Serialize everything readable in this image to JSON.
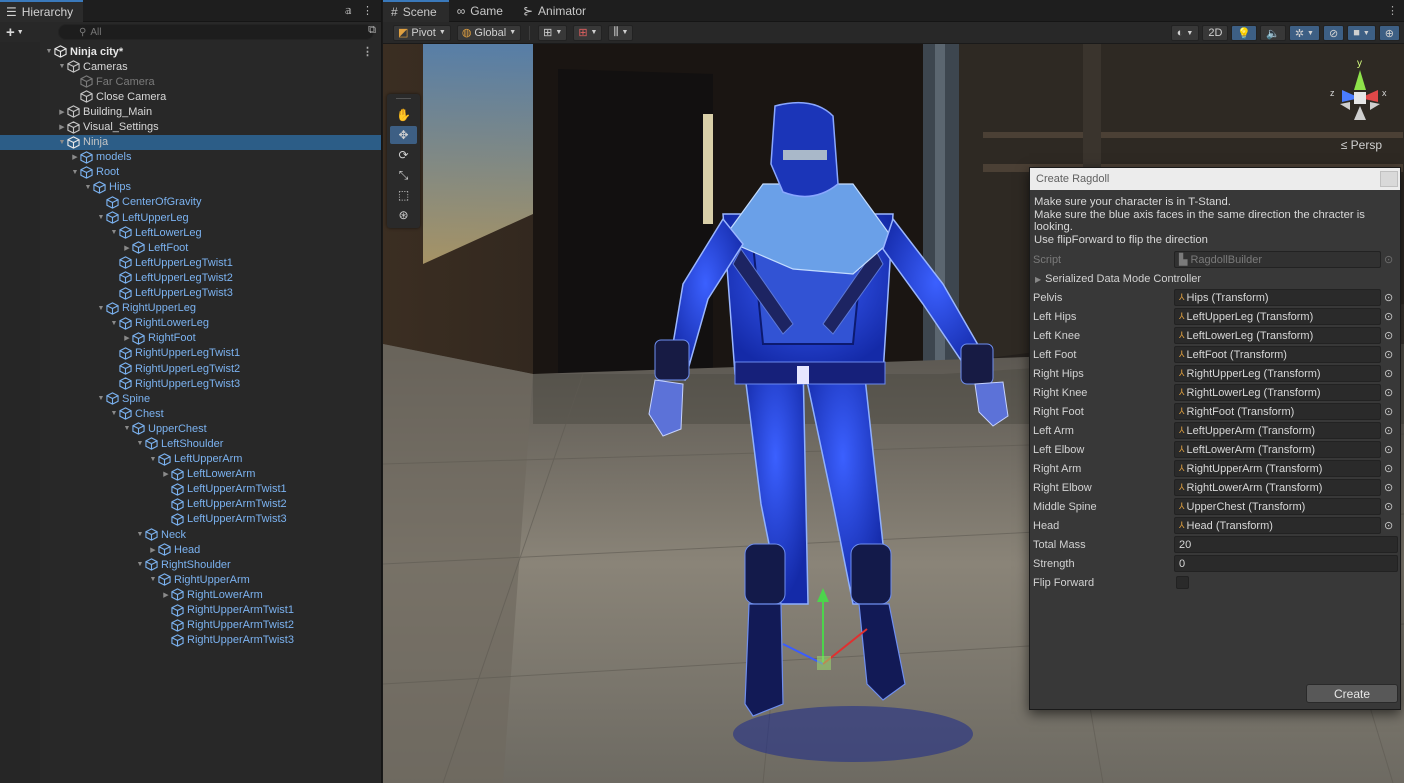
{
  "hierarchy": {
    "tab_label": "Hierarchy",
    "search_placeholder": "All",
    "items": [
      {
        "label": "Ninja city*",
        "depth": 0,
        "arrow": "▼",
        "style": "scene"
      },
      {
        "label": "Cameras",
        "depth": 1,
        "arrow": "▼",
        "style": "white"
      },
      {
        "label": "Far Camera",
        "depth": 2,
        "arrow": "",
        "style": "dim"
      },
      {
        "label": "Close Camera",
        "depth": 2,
        "arrow": "",
        "style": "white"
      },
      {
        "label": "Building_Main",
        "depth": 1,
        "arrow": "▶",
        "style": "white"
      },
      {
        "label": "Visual_Settings",
        "depth": 1,
        "arrow": "▶",
        "style": "white"
      },
      {
        "label": "Ninja",
        "depth": 1,
        "arrow": "▼",
        "style": "selected"
      },
      {
        "label": "models",
        "depth": 2,
        "arrow": "▶",
        "style": "blue"
      },
      {
        "label": "Root",
        "depth": 2,
        "arrow": "▼",
        "style": "blue"
      },
      {
        "label": "Hips",
        "depth": 3,
        "arrow": "▼",
        "style": "blue"
      },
      {
        "label": "CenterOfGravity",
        "depth": 4,
        "arrow": "",
        "style": "blue"
      },
      {
        "label": "LeftUpperLeg",
        "depth": 4,
        "arrow": "▼",
        "style": "blue"
      },
      {
        "label": "LeftLowerLeg",
        "depth": 5,
        "arrow": "▼",
        "style": "blue"
      },
      {
        "label": "LeftFoot",
        "depth": 6,
        "arrow": "▶",
        "style": "blue"
      },
      {
        "label": "LeftUpperLegTwist1",
        "depth": 5,
        "arrow": "",
        "style": "blue"
      },
      {
        "label": "LeftUpperLegTwist2",
        "depth": 5,
        "arrow": "",
        "style": "blue"
      },
      {
        "label": "LeftUpperLegTwist3",
        "depth": 5,
        "arrow": "",
        "style": "blue"
      },
      {
        "label": "RightUpperLeg",
        "depth": 4,
        "arrow": "▼",
        "style": "blue"
      },
      {
        "label": "RightLowerLeg",
        "depth": 5,
        "arrow": "▼",
        "style": "blue"
      },
      {
        "label": "RightFoot",
        "depth": 6,
        "arrow": "▶",
        "style": "blue"
      },
      {
        "label": "RightUpperLegTwist1",
        "depth": 5,
        "arrow": "",
        "style": "blue"
      },
      {
        "label": "RightUpperLegTwist2",
        "depth": 5,
        "arrow": "",
        "style": "blue"
      },
      {
        "label": "RightUpperLegTwist3",
        "depth": 5,
        "arrow": "",
        "style": "blue"
      },
      {
        "label": "Spine",
        "depth": 4,
        "arrow": "▼",
        "style": "blue"
      },
      {
        "label": "Chest",
        "depth": 5,
        "arrow": "▼",
        "style": "blue"
      },
      {
        "label": "UpperChest",
        "depth": 6,
        "arrow": "▼",
        "style": "blue"
      },
      {
        "label": "LeftShoulder",
        "depth": 7,
        "arrow": "▼",
        "style": "blue"
      },
      {
        "label": "LeftUpperArm",
        "depth": 8,
        "arrow": "▼",
        "style": "blue"
      },
      {
        "label": "LeftLowerArm",
        "depth": 9,
        "arrow": "▶",
        "style": "blue"
      },
      {
        "label": "LeftUpperArmTwist1",
        "depth": 9,
        "arrow": "",
        "style": "blue"
      },
      {
        "label": "LeftUpperArmTwist2",
        "depth": 9,
        "arrow": "",
        "style": "blue"
      },
      {
        "label": "LeftUpperArmTwist3",
        "depth": 9,
        "arrow": "",
        "style": "blue"
      },
      {
        "label": "Neck",
        "depth": 7,
        "arrow": "▼",
        "style": "blue"
      },
      {
        "label": "Head",
        "depth": 8,
        "arrow": "▶",
        "style": "blue"
      },
      {
        "label": "RightShoulder",
        "depth": 7,
        "arrow": "▼",
        "style": "blue"
      },
      {
        "label": "RightUpperArm",
        "depth": 8,
        "arrow": "▼",
        "style": "blue"
      },
      {
        "label": "RightLowerArm",
        "depth": 9,
        "arrow": "▶",
        "style": "blue"
      },
      {
        "label": "RightUpperArmTwist1",
        "depth": 9,
        "arrow": "",
        "style": "blue"
      },
      {
        "label": "RightUpperArmTwist2",
        "depth": 9,
        "arrow": "",
        "style": "blue"
      },
      {
        "label": "RightUpperArmTwist3",
        "depth": 9,
        "arrow": "",
        "style": "blue"
      }
    ]
  },
  "tabs": {
    "scene": "Scene",
    "game": "Game",
    "animator": "Animator"
  },
  "toolbar": {
    "pivot": "Pivot",
    "global": "Global",
    "mode_2d": "2D"
  },
  "scene_view": {
    "persp_label": "Persp",
    "gizmo_axes": {
      "x": "x",
      "y": "y",
      "z": "z"
    }
  },
  "ragdoll": {
    "title": "Create Ragdoll",
    "help_lines": [
      "Make sure your character is in T-Stand.",
      "Make sure the blue axis faces in the same direction the chracter is looking.",
      "Use flipForward to flip the direction"
    ],
    "script_label": "Script",
    "script_value": "RagdollBuilder",
    "foldout_label": "Serialized Data Mode Controller",
    "fields": [
      {
        "label": "Pelvis",
        "value": "Hips (Transform)"
      },
      {
        "label": "Left Hips",
        "value": "LeftUpperLeg (Transform)"
      },
      {
        "label": "Left Knee",
        "value": "LeftLowerLeg (Transform)"
      },
      {
        "label": "Left Foot",
        "value": "LeftFoot (Transform)"
      },
      {
        "label": "Right Hips",
        "value": "RightUpperLeg (Transform)"
      },
      {
        "label": "Right Knee",
        "value": "RightLowerLeg (Transform)"
      },
      {
        "label": "Right Foot",
        "value": "RightFoot (Transform)"
      },
      {
        "label": "Left Arm",
        "value": "LeftUpperArm (Transform)"
      },
      {
        "label": "Left Elbow",
        "value": "LeftLowerArm (Transform)"
      },
      {
        "label": "Right Arm",
        "value": "RightUpperArm (Transform)"
      },
      {
        "label": "Right Elbow",
        "value": "RightLowerArm (Transform)"
      },
      {
        "label": "Middle Spine",
        "value": "UpperChest (Transform)"
      },
      {
        "label": "Head",
        "value": "Head (Transform)"
      }
    ],
    "total_mass_label": "Total Mass",
    "total_mass_value": "20",
    "strength_label": "Strength",
    "strength_value": "0",
    "flip_forward_label": "Flip Forward",
    "create_label": "Create"
  },
  "colors": {
    "accent": "#3a79bb",
    "selection": "#2c5d87",
    "prefab_blue": "#7bb2f0",
    "ninja_blue": "#1f3fd1"
  }
}
